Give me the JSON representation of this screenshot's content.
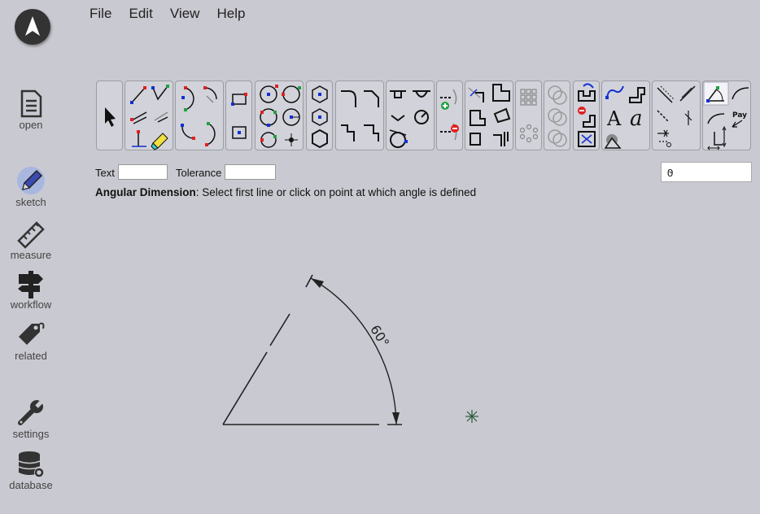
{
  "menu": {
    "file": "File",
    "edit": "Edit",
    "view": "View",
    "help": "Help"
  },
  "sidebar": {
    "open": "open",
    "sketch": "sketch",
    "measure": "measure",
    "workflow": "workflow",
    "related": "related",
    "settings": "settings",
    "database": "database"
  },
  "props": {
    "text_label": "Text",
    "tolerance_label": "Tolerance",
    "text_value": "",
    "tolerance_value": ""
  },
  "layer": {
    "value": "0"
  },
  "status": {
    "tool": "Angular Dimension",
    "message": ": Select first line or click on point at which angle is defined"
  },
  "toolbar": {
    "text_tool_glyph": "A",
    "script_text_glyph": "a",
    "pay_label": "Pay"
  },
  "drawing": {
    "angle_label": "60°"
  },
  "colors": {
    "background": "#c9c9d1",
    "sketch_active": "#5b7de6",
    "point_red": "#e02020",
    "point_blue": "#1030d0",
    "point_green": "#20a040"
  }
}
